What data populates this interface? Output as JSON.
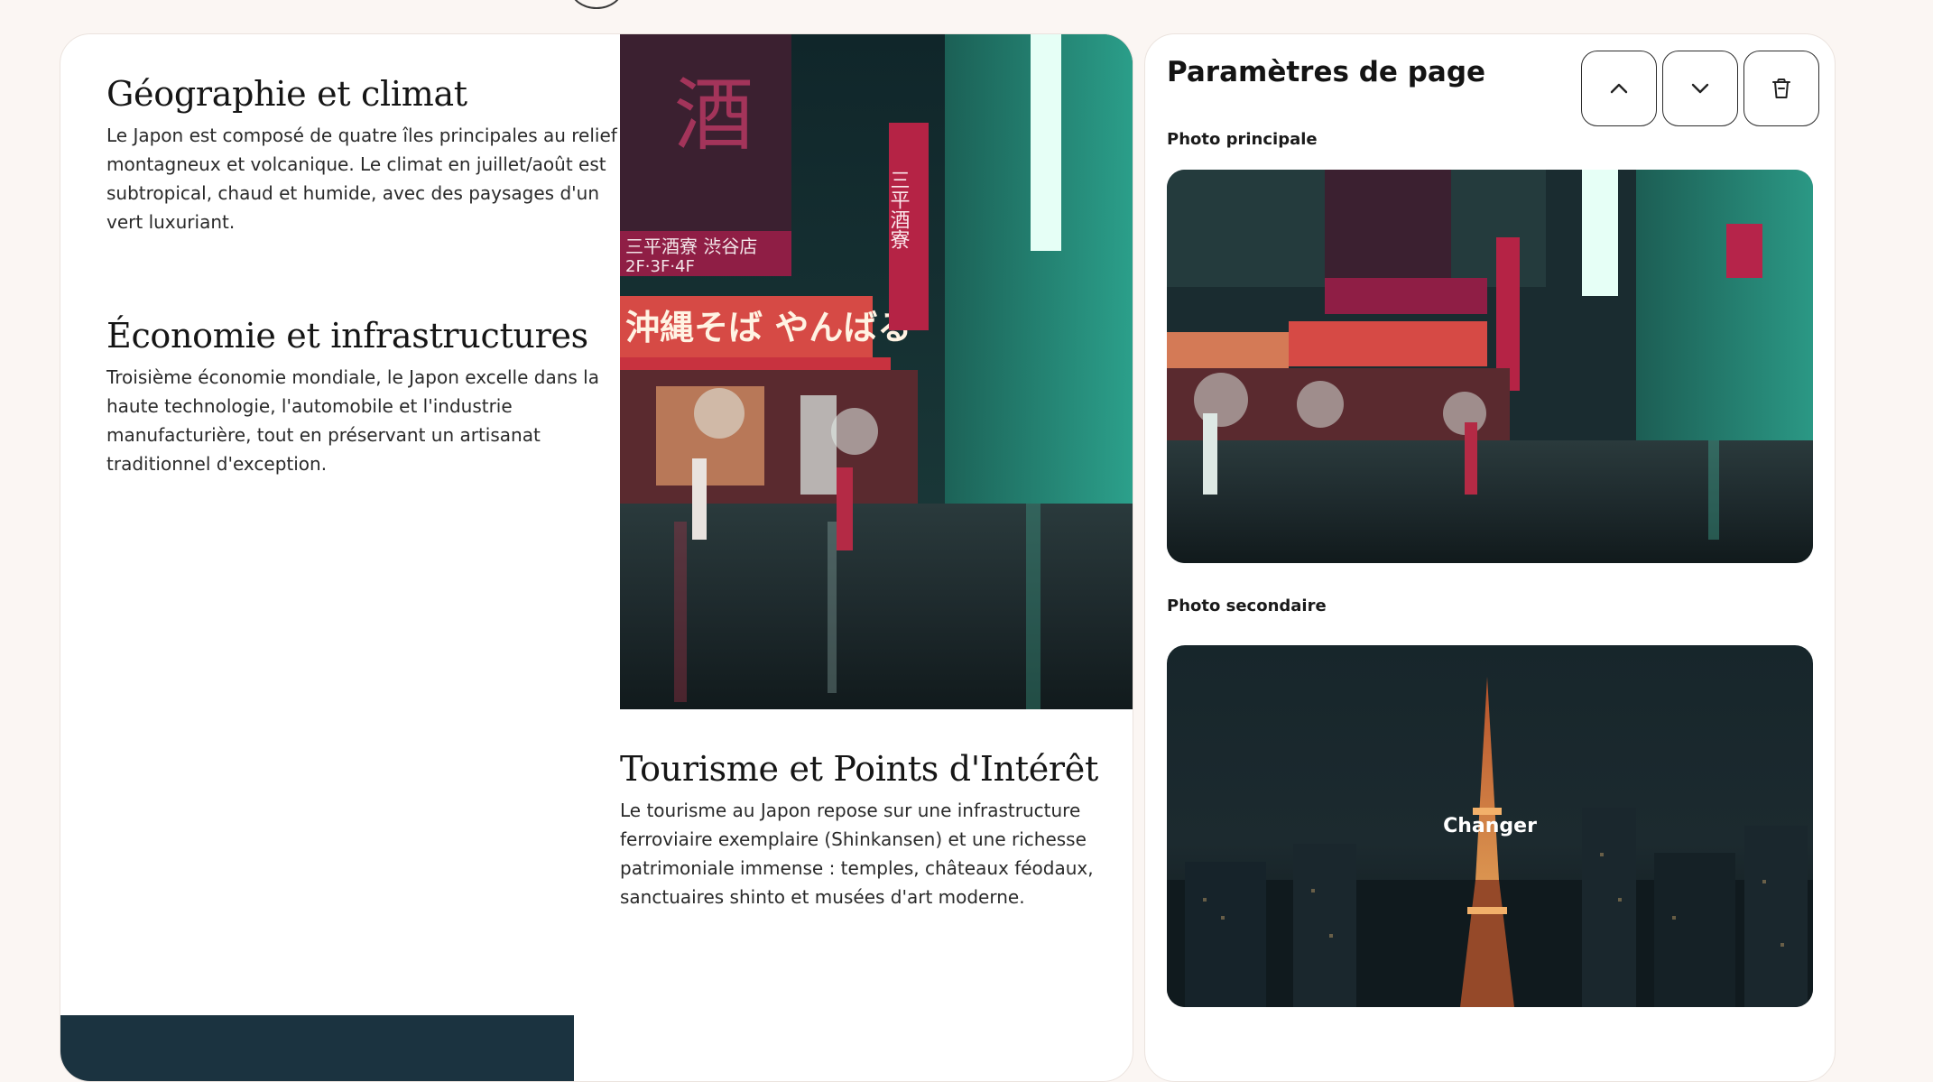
{
  "page": {
    "sections": {
      "geographie": {
        "title": "Géographie et climat",
        "text": "Le Japon est composé de quatre îles principales au relief montagneux et volcanique. Le climat en juillet/août est subtropical, chaud et humide, avec des paysages d'un vert luxuriant."
      },
      "economie": {
        "title": "Économie et infrastructures",
        "text": "Troisième économie mondiale, le Japon excelle dans la haute technologie, l'automobile et l'industrie manufacturière, tout en préservant un artisanat traditionnel d'exception."
      },
      "tourisme": {
        "title": "Tourisme et Points d'Intérêt",
        "text": "Le tourisme au Japon repose sur une infrastructure ferroviaire exemplaire (Shinkansen) et une richesse patrimoniale immense : temples, châteaux féodaux, sanctuaires shinto et musées d'art moderne."
      }
    },
    "photo_signs": {
      "vertical_left": "酒",
      "sake_house": "三平酒寮  渋谷店",
      "floors": "2F·3F·4F",
      "noodles": "沖縄そば やんばる",
      "vertical_right": "三平酒寮"
    }
  },
  "settings": {
    "title": "Paramètres de page",
    "buttons": {
      "up_icon": "chevron-up-icon",
      "down_icon": "chevron-down-icon",
      "delete_icon": "trash-icon"
    },
    "main_photo_label": "Photo principale",
    "secondary_photo_label": "Photo secondaire",
    "change_label": "Changer"
  },
  "colors": {
    "background": "#fbf6f3",
    "card": "#ffffff",
    "text": "#1c1c1c"
  }
}
